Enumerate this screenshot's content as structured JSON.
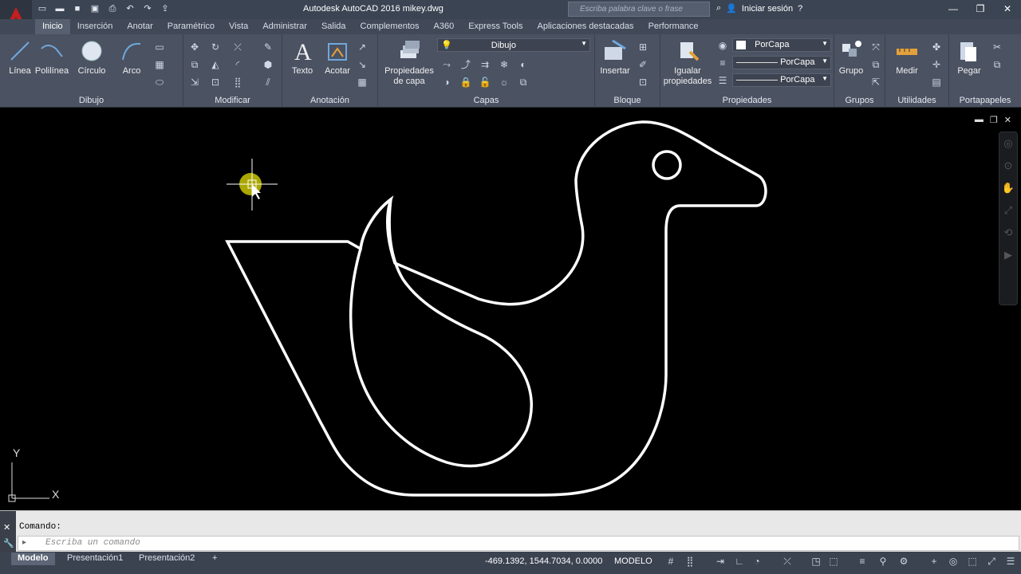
{
  "window": {
    "title": "Autodesk AutoCAD 2016   mikey.dwg",
    "search_placeholder": "Escriba palabra clave o frase",
    "signin": "Iniciar sesión"
  },
  "tabs": [
    "Inicio",
    "Inserción",
    "Anotar",
    "Paramétrico",
    "Vista",
    "Administrar",
    "Salida",
    "Complementos",
    "A360",
    "Express Tools",
    "Aplicaciones destacadas",
    "Performance"
  ],
  "ribbon": {
    "dibujo": {
      "title": "Dibujo",
      "linea": "Línea",
      "polilinea": "Polilínea",
      "circulo": "Círculo",
      "arco": "Arco"
    },
    "modificar": {
      "title": "Modificar"
    },
    "anotacion": {
      "title": "Anotación",
      "texto": "Texto",
      "acotar": "Acotar"
    },
    "capas": {
      "title": "Capas",
      "propiedades": "Propiedades de capa",
      "layer": "Dibujo"
    },
    "bloque": {
      "title": "Bloque",
      "insertar": "Insertar"
    },
    "propiedades": {
      "title": "Propiedades",
      "igualar": "Igualar propiedades",
      "color": "PorCapa",
      "linetype": "PorCapa",
      "lineweight": "PorCapa"
    },
    "grupos": {
      "title": "Grupos",
      "grupo": "Grupo"
    },
    "utilidades": {
      "title": "Utilidades",
      "medir": "Medir"
    },
    "portapapeles": {
      "title": "Portapapeles",
      "pegar": "Pegar"
    }
  },
  "command": {
    "history": "Comando:",
    "placeholder": "Escriba un comando"
  },
  "status": {
    "tabs": [
      "Modelo",
      "Presentación1",
      "Presentación2"
    ],
    "coords": "-469.1392, 1544.7034, 0.0000",
    "mode": "MODELO"
  },
  "ucs": {
    "x": "X",
    "y": "Y"
  },
  "colors": {
    "accent": "#c41f1f",
    "canvas": "#000000",
    "ribbon": "#4b5262"
  }
}
